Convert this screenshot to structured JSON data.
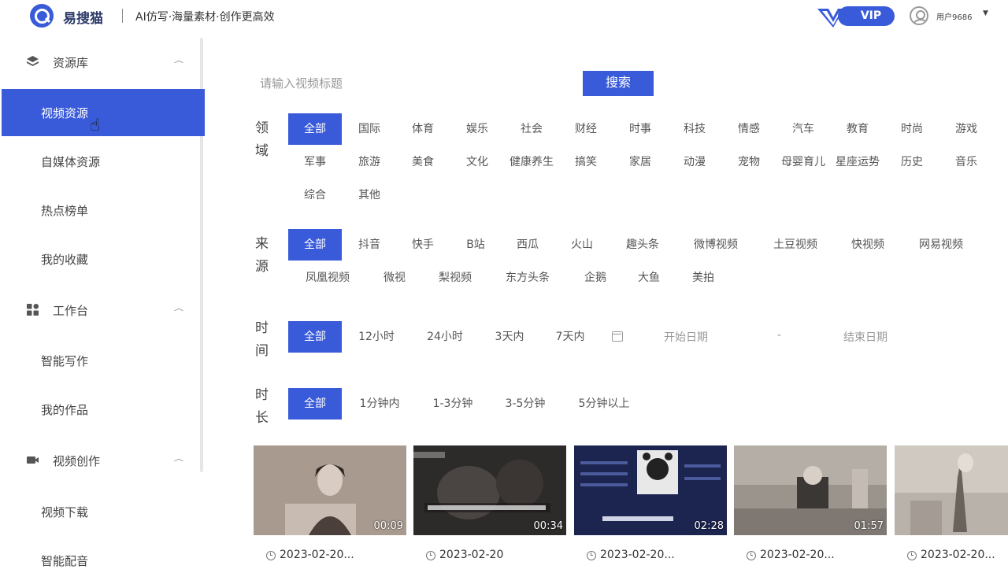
{
  "header": {
    "logo_name": "易搜猫",
    "slogan": "AI仿写·海量素材·创作更高效",
    "vip_label": "VIP",
    "username": "用户9686"
  },
  "sidebar": {
    "groups": [
      {
        "label": "资源库",
        "icon": "database-icon",
        "items": [
          "视频资源",
          "自媒体资源",
          "热点榜单",
          "我的收藏"
        ]
      },
      {
        "label": "工作台",
        "icon": "dashboard-icon",
        "items": [
          "智能写作",
          "我的作品"
        ]
      },
      {
        "label": "视频创作",
        "icon": "video-camera-icon",
        "items": [
          "视频下载",
          "智能配音"
        ]
      }
    ],
    "active_item": "视频资源"
  },
  "search": {
    "placeholder": "请输入视频标题",
    "button": "搜索"
  },
  "filters": {
    "domain": {
      "label_1": "领",
      "label_2": "域",
      "options": [
        "全部",
        "国际",
        "体育",
        "娱乐",
        "社会",
        "财经",
        "时事",
        "科技",
        "情感",
        "汽车",
        "教育",
        "时尚",
        "游戏",
        "军事",
        "旅游",
        "美食",
        "文化",
        "健康养生",
        "搞笑",
        "家居",
        "动漫",
        "宠物",
        "母婴育儿",
        "星座运势",
        "历史",
        "音乐",
        "综合",
        "其他"
      ],
      "selected": "全部"
    },
    "source": {
      "label_1": "来",
      "label_2": "源",
      "options": [
        "全部",
        "抖音",
        "快手",
        "B站",
        "西瓜",
        "火山",
        "趣头条",
        "微博视频",
        "土豆视频",
        "快视频",
        "网易视频",
        "凤凰视频",
        "微视",
        "梨视频",
        "东方头条",
        "企鹅",
        "大鱼",
        "美拍"
      ],
      "selected": "全部"
    },
    "time": {
      "label_1": "时",
      "label_2": "间",
      "options": [
        "全部",
        "12小时",
        "24小时",
        "3天内",
        "7天内"
      ],
      "selected": "全部",
      "start_placeholder": "开始日期",
      "separator": "-",
      "end_placeholder": "结束日期"
    },
    "duration": {
      "label_1": "时",
      "label_2": "长",
      "options": [
        "全部",
        "1分钟内",
        "1-3分钟",
        "3-5分钟",
        "5分钟以上"
      ],
      "selected": "全部"
    }
  },
  "videos": [
    {
      "duration": "00:09",
      "date": "2023-02-20..."
    },
    {
      "duration": "00:34",
      "date": "2023-02-20"
    },
    {
      "duration": "02:28",
      "date": "2023-02-20..."
    },
    {
      "duration": "01:57",
      "date": "2023-02-20..."
    },
    {
      "duration": "",
      "date": "2023-02-20..."
    }
  ],
  "colors": {
    "accent": "#3a5bd9"
  }
}
